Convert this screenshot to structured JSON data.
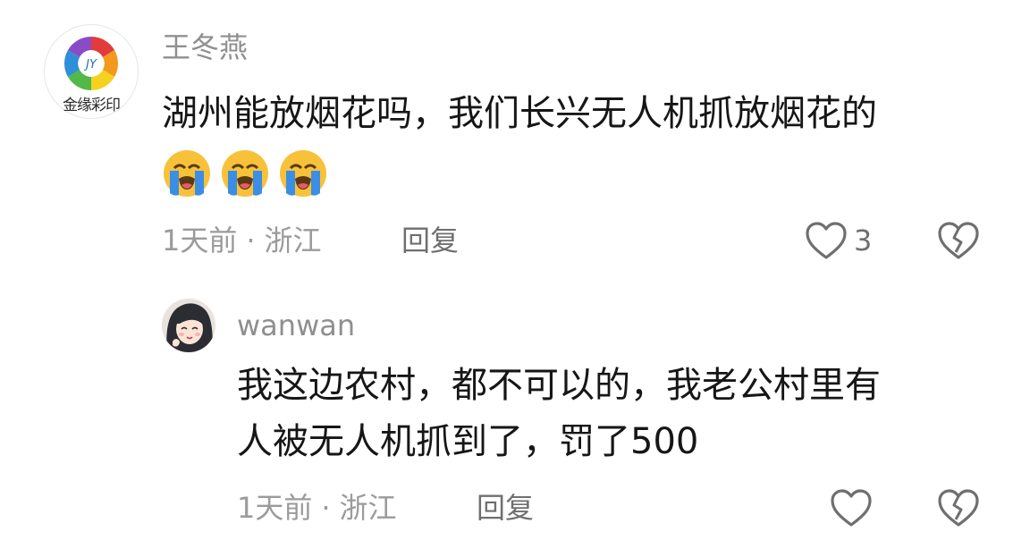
{
  "comment": {
    "username": "王冬燕",
    "avatar_logo_text": "金缘彩印",
    "text_line1": "湖州能放烟花吗，我们长兴无人机抓放烟花的",
    "emojis": [
      "loudly-crying-face",
      "loudly-crying-face",
      "loudly-crying-face"
    ],
    "time": "1天前",
    "location": "浙江",
    "separator": "·",
    "reply_label": "回复",
    "like_count": "3"
  },
  "reply": {
    "username": "wanwan",
    "text_line1": "我这边农村，都不可以的，我老公村里有",
    "text_line2": "人被无人机抓到了，罚了500",
    "time": "1天前",
    "location": "浙江",
    "separator": "·",
    "reply_label": "回复"
  },
  "icons": {
    "like": "heart-outline-icon",
    "dislike": "broken-heart-outline-icon"
  },
  "colors": {
    "text": "#161616",
    "muted": "#9b9b9b",
    "icon": "#6f6f6f",
    "emoji_face": "#f7c13a",
    "emoji_tears": "#3a8ee6"
  }
}
